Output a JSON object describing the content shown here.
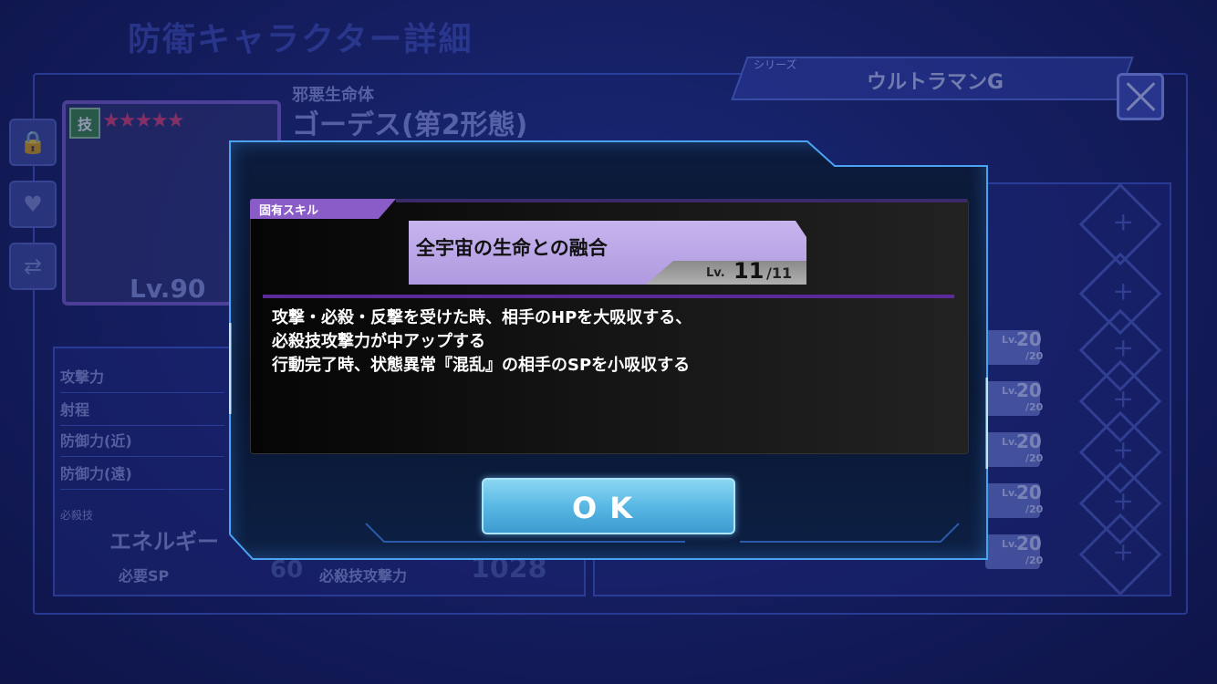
{
  "background": {
    "title": "防衛キャラクター詳細",
    "series_label": "シリーズ",
    "series_value": "ウルトラマンG",
    "card_skill_icon": "技",
    "card_stars": "★★★★★",
    "card_level": "Lv.90",
    "char_subtitle": "邪悪生命体",
    "char_name": "ゴーデス(第2形態)",
    "stats": [
      "攻撃力",
      "射程",
      "防御力(近)",
      "防御力(遠)"
    ],
    "special_label": "必殺技",
    "special_name": "エネルギー",
    "sp_label": "必要SP",
    "sp_value": "60",
    "special_atk_label": "必殺技攻撃力",
    "special_atk_value": "1028",
    "skill_rows": [
      {
        "lv": "Lv.",
        "num": "20",
        "max": "/20"
      },
      {
        "lv": "Lv.",
        "num": "20",
        "max": "/20"
      },
      {
        "lv": "Lv.",
        "num": "20",
        "max": "/20"
      },
      {
        "lv": "Lv.",
        "num": "20",
        "max": "/20"
      },
      {
        "lv": "Lv.",
        "num": "20",
        "max": "/20"
      }
    ]
  },
  "modal": {
    "tag": "固有スキル",
    "skill_name": "全宇宙の生命との融合",
    "level_prefix": "Lv.",
    "level": "11",
    "level_max": "/11",
    "description": [
      "攻撃・必殺・反撃を受けた時、相手のHPを大吸収する、",
      "必殺技攻撃力が中アップする",
      "行動完了時、状態異常『混乱』の相手のSPを小吸収する"
    ],
    "ok_label": "OK"
  },
  "colors": {
    "accent_purple": "#8a5cc8",
    "skill_name_bg": "#c6b4ee",
    "ok_button": "#5ab8e4",
    "modal_border": "#3d8ae0"
  },
  "icons": [
    "lock-icon",
    "heart-icon",
    "swap-icon",
    "close-icon",
    "target-icon"
  ]
}
